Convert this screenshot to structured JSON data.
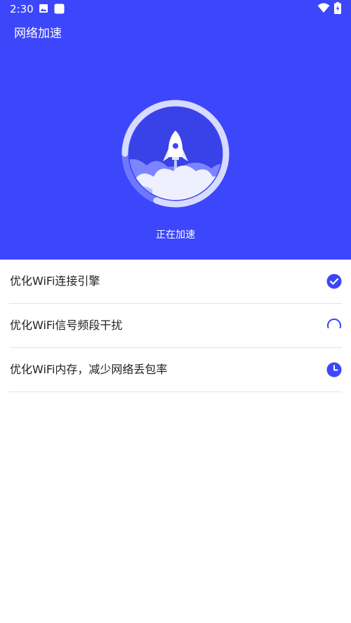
{
  "status_bar": {
    "time": "2:30",
    "icons": [
      "image-icon",
      "square-app-icon",
      "wifi-icon",
      "battery-charging-icon"
    ]
  },
  "app": {
    "title": "网络加速"
  },
  "hero": {
    "icon": "rocket-icon",
    "caption": "正在加速"
  },
  "tasks": [
    {
      "label": "优化WiFi连接引擎",
      "status": "done",
      "status_icon": "check-circle-icon"
    },
    {
      "label": "优化WiFi信号频段干扰",
      "status": "in-progress",
      "status_icon": "spinner-icon"
    },
    {
      "label": "优化WiFi内存，减少网络丢包率",
      "status": "pending",
      "status_icon": "clock-icon"
    }
  ],
  "colors": {
    "primary": "#3c46fb",
    "text": "#222222",
    "divider": "#e3e3e3",
    "white": "#ffffff"
  }
}
